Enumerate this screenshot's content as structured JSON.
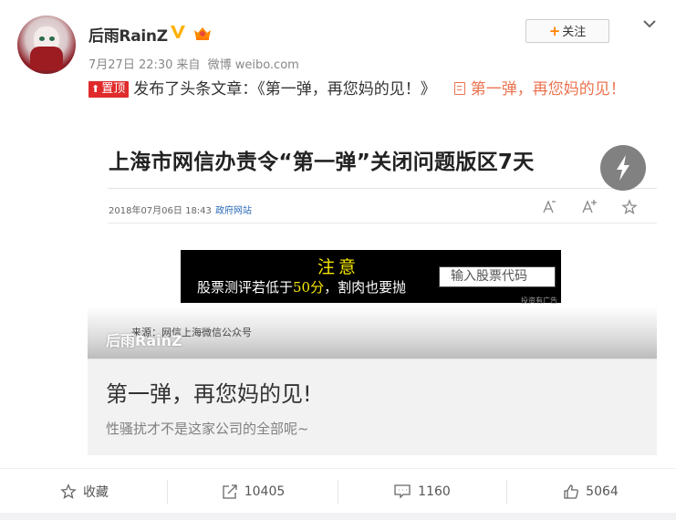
{
  "user": {
    "name": "后雨RainZ",
    "time": "7月27日 22:30",
    "from_label": "来自",
    "source": "微博 weibo.com",
    "follow_label": "关注"
  },
  "post": {
    "pin_label": "置顶",
    "text": "发布了头条文章：《第一弹，再您妈的见！》",
    "article_link": "第一弹，再您妈的见！"
  },
  "card": {
    "cover": {
      "headline": "上海市网信办责令“第一弹”关闭问题版区7天",
      "date": "2018年07月06日 18:43",
      "source": "政府网站",
      "ad_headline": "注意",
      "ad_text_before": "股票测评若低于",
      "ad_text_highlight": "50分",
      "ad_text_after": "，割肉也要抛",
      "ad_input": "输入股票代码",
      "ad_disclaimer": "投资有广告",
      "footnote": "来源：网信上海微信公众号",
      "watermark": "后雨RainZ"
    },
    "title": "第一弹，再您妈的见!",
    "description": "性骚扰才不是这家公司的全部呢~"
  },
  "actions": {
    "favorite_label": "收藏",
    "repost_count": "10405",
    "comment_count": "1160",
    "like_count": "5064"
  },
  "colors": {
    "accent_orange": "#ff8200",
    "link": "#eb7350",
    "pin_red": "#e02b2b",
    "ad_yellow": "#f5e600"
  }
}
